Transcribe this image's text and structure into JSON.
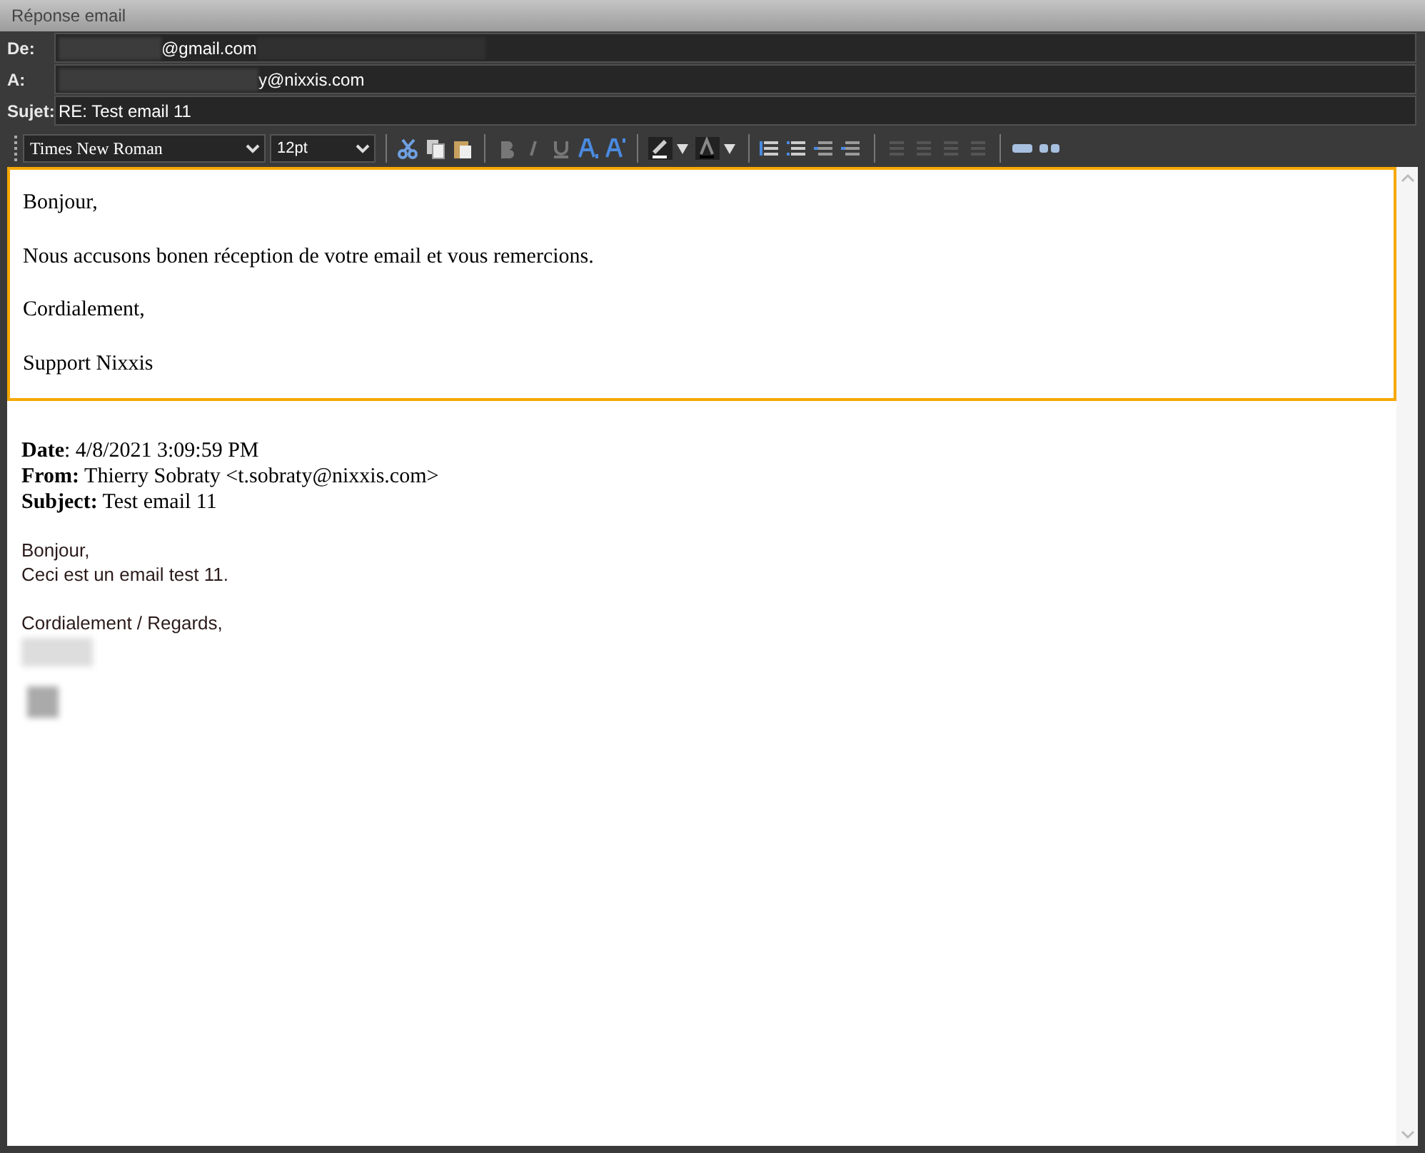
{
  "window": {
    "title": "Réponse email"
  },
  "fields": [
    {
      "label": "De:",
      "value": "@gmail.com"
    },
    {
      "label": "A:",
      "value": "y@nixxis.com"
    },
    {
      "label": "Sujet:",
      "value": "RE: Test email 11"
    }
  ],
  "toolbar": {
    "font": "Times New Roman",
    "size": "12pt"
  },
  "editor": {
    "paragraphs": [
      "Bonjour,",
      "Nous accusons bonen réception de votre email et vous remercions.",
      "Cordialement,",
      "Support Nixxis"
    ]
  },
  "quoted": {
    "headers": [
      "**Date**: 4/8/2021 3:09:59 PM",
      "**From:** Thierry Sobraty <t.sobraty@nixxis.com>",
      "**Subject:** Test email 11"
    ],
    "body": [
      [
        "Bonjour,",
        "Ceci est un email test 11."
      ],
      [
        "Cordialement / Regards,"
      ]
    ]
  }
}
